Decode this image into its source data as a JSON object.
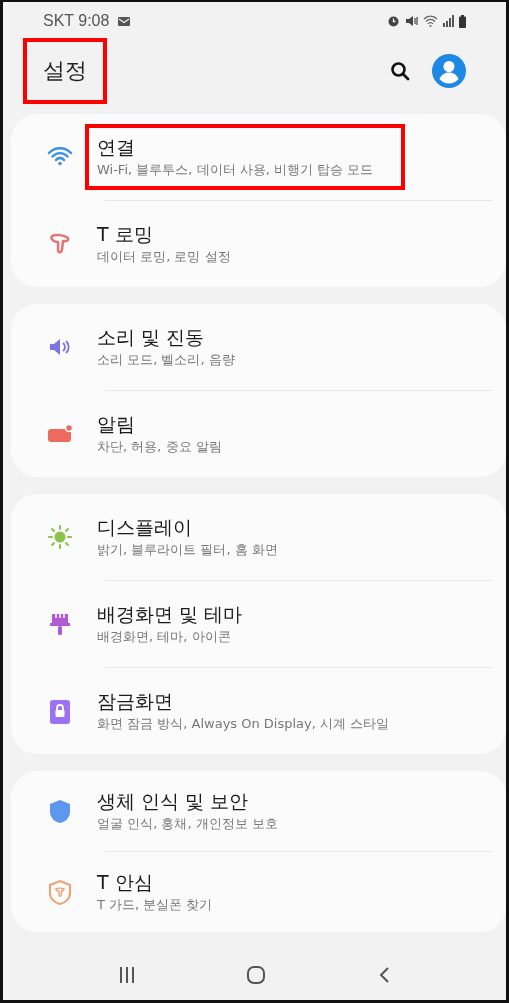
{
  "status_bar": {
    "carrier_time": "SKT 9:08"
  },
  "header": {
    "title": "설정",
    "title_highlighted": true
  },
  "groups": [
    {
      "items": [
        {
          "title": "연결",
          "subtitle": "Wi-Fi, 블루투스, 데이터 사용, 비행기 탑승 모드",
          "highlighted": true
        },
        {
          "title": "T 로밍",
          "subtitle": "데이터 로밍, 로밍 설정",
          "highlighted": false
        }
      ]
    },
    {
      "items": [
        {
          "title": "소리 및 진동",
          "subtitle": "소리 모드, 벨소리, 음량",
          "highlighted": false
        },
        {
          "title": "알림",
          "subtitle": "차단, 허용, 중요 알림",
          "highlighted": false
        }
      ]
    },
    {
      "items": [
        {
          "title": "디스플레이",
          "subtitle": "밝기, 블루라이트 필터, 홈 화면",
          "highlighted": false
        },
        {
          "title": "배경화면 및 테마",
          "subtitle": "배경화면, 테마, 아이콘",
          "highlighted": false
        },
        {
          "title": "잠금화면",
          "subtitle": "화면 잠금 방식, Always On Display, 시계 스타일",
          "highlighted": false
        }
      ]
    },
    {
      "items": [
        {
          "title": "생체 인식 및 보안",
          "subtitle": "얼굴 인식, 홍채, 개인정보 보호",
          "highlighted": false
        },
        {
          "title": "T 안심",
          "subtitle": "T 가드, 분실폰 찾기",
          "highlighted": false
        }
      ]
    }
  ]
}
